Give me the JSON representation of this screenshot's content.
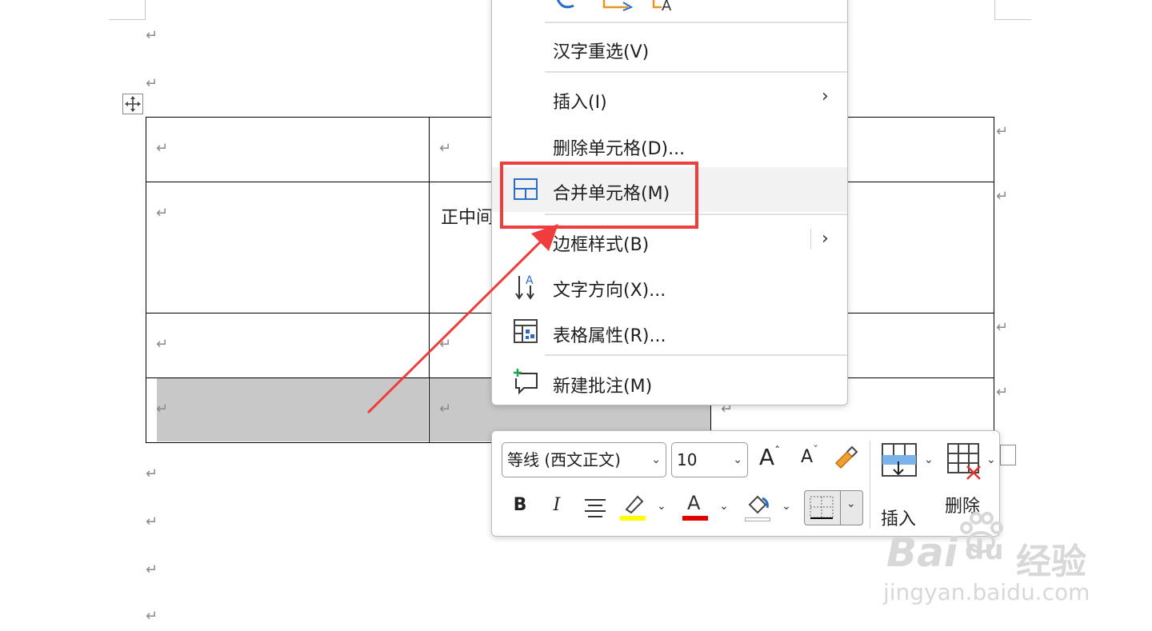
{
  "document": {
    "para_mark": "↵",
    "table_cell_text": "正中间"
  },
  "context_menu": {
    "items": [
      {
        "label": "汉字重选(V)",
        "has_submenu": false
      },
      {
        "label": "插入(I)",
        "has_submenu": true
      },
      {
        "label": "删除单元格(D)...",
        "has_submenu": false
      },
      {
        "label": "合并单元格(M)",
        "has_submenu": false,
        "highlighted": true
      },
      {
        "label": "边框样式(B)",
        "has_submenu": true
      },
      {
        "label": "文字方向(X)...",
        "has_submenu": false
      },
      {
        "label": "表格属性(R)...",
        "has_submenu": false
      },
      {
        "label": "新建批注(M)",
        "has_submenu": false
      }
    ],
    "submenu_glyph": "›"
  },
  "mini_toolbar": {
    "font_name": "等线 (西文正文)",
    "font_size": "10",
    "grow_font": "A",
    "shrink_font": "A",
    "bold": "B",
    "italic": "I",
    "font_color_glyph": "A",
    "highlight_color": "#ffff00",
    "font_color": "#e00000",
    "insert_label": "插入",
    "delete_label": "删除"
  },
  "annotation": {
    "arrow_color": "#ef3c3c",
    "box_color": "#ef3c3c"
  },
  "watermark": {
    "brand": "Bai",
    "brand_tail": "du",
    "product": "经验",
    "url": "jingyan.baidu.com"
  }
}
